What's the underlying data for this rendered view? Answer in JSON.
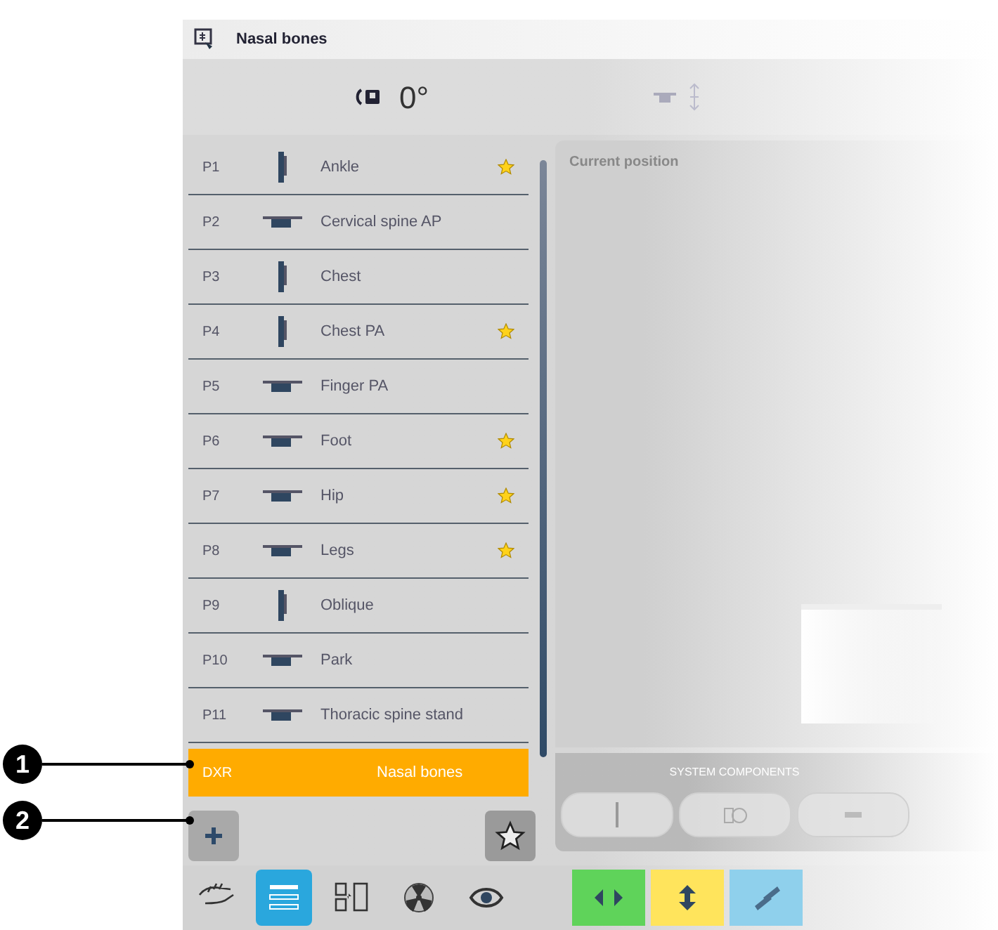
{
  "header": {
    "title": "Nasal bones"
  },
  "angle": {
    "value": "0°"
  },
  "programs": [
    {
      "number": "P1",
      "kind": "stand",
      "name": "Ankle",
      "favorite": true,
      "selected": false
    },
    {
      "number": "P2",
      "kind": "table",
      "name": "Cervical spine AP",
      "favorite": false,
      "selected": false
    },
    {
      "number": "P3",
      "kind": "stand",
      "name": "Chest",
      "favorite": false,
      "selected": false
    },
    {
      "number": "P4",
      "kind": "stand",
      "name": "Chest PA",
      "favorite": true,
      "selected": false
    },
    {
      "number": "P5",
      "kind": "table",
      "name": "Finger PA",
      "favorite": false,
      "selected": false
    },
    {
      "number": "P6",
      "kind": "table",
      "name": "Foot",
      "favorite": true,
      "selected": false
    },
    {
      "number": "P7",
      "kind": "table",
      "name": "Hip",
      "favorite": true,
      "selected": false
    },
    {
      "number": "P8",
      "kind": "table",
      "name": "Legs",
      "favorite": true,
      "selected": false
    },
    {
      "number": "P9",
      "kind": "stand",
      "name": "Oblique",
      "favorite": false,
      "selected": false
    },
    {
      "number": "P10",
      "kind": "table",
      "name": "Park",
      "favorite": false,
      "selected": false
    },
    {
      "number": "P11",
      "kind": "table",
      "name": "Thoracic spine stand",
      "favorite": false,
      "selected": false
    },
    {
      "number": "DXR",
      "kind": "none",
      "name": "Nasal bones",
      "favorite": false,
      "selected": true
    }
  ],
  "position_panel": {
    "title": "Current position"
  },
  "system_components": {
    "title": "SYSTEM COMPONENTS",
    "items": [
      {
        "kind": "stand"
      },
      {
        "kind": "tube"
      },
      {
        "kind": "table"
      }
    ]
  },
  "tabs": [
    {
      "kind": "hand",
      "selected": false
    },
    {
      "kind": "list",
      "selected": true
    },
    {
      "kind": "transfer",
      "selected": false
    },
    {
      "kind": "radiation",
      "selected": false
    },
    {
      "kind": "eye",
      "selected": false
    }
  ],
  "motion_buttons": [
    {
      "kind": "horizontal",
      "color": "#5fd35a"
    },
    {
      "kind": "vertical",
      "color": "#ffe45c"
    },
    {
      "kind": "tilt",
      "color": "#8fd0ec"
    }
  ],
  "callouts": [
    {
      "label": "1"
    },
    {
      "label": "2"
    }
  ]
}
